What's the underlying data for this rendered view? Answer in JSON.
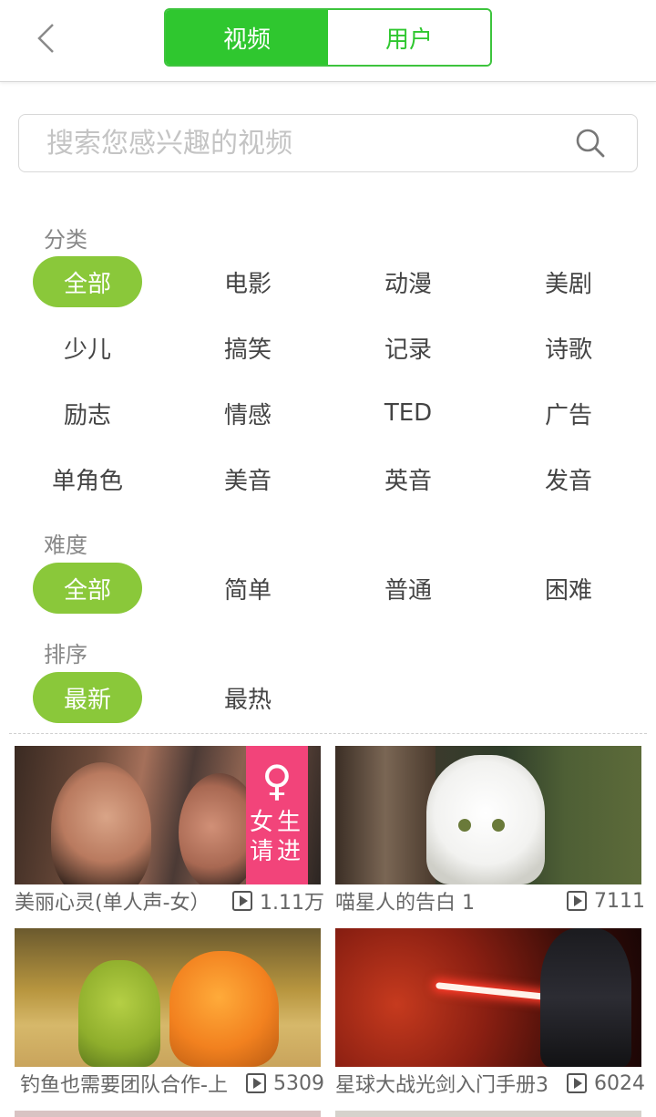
{
  "header": {
    "tabs": [
      {
        "label": "视频",
        "active": true
      },
      {
        "label": "用户",
        "active": false
      }
    ]
  },
  "search": {
    "placeholder": "搜索您感兴趣的视频"
  },
  "filters": {
    "category": {
      "label": "分类",
      "items": [
        "全部",
        "电影",
        "动漫",
        "美剧",
        "少儿",
        "搞笑",
        "记录",
        "诗歌",
        "励志",
        "情感",
        "TED",
        "广告",
        "单角色",
        "美音",
        "英音",
        "发音"
      ],
      "selected": "全部"
    },
    "difficulty": {
      "label": "难度",
      "items": [
        "全部",
        "简单",
        "普通",
        "困难"
      ],
      "selected": "全部"
    },
    "sort": {
      "label": "排序",
      "items": [
        "最新",
        "最热"
      ],
      "selected": "最新"
    }
  },
  "videos": [
    {
      "title": "美丽心灵(单人声-女）",
      "views": "1.11万",
      "badge": {
        "symbol": "♀",
        "line1": "女生",
        "line2": "请进"
      }
    },
    {
      "title": "喵星人的告白 1",
      "views": "7111"
    },
    {
      "title": "钓鱼也需要团队合作-上",
      "views": "5309"
    },
    {
      "title": "星球大战光剑入门手册3",
      "views": "6024"
    }
  ],
  "colors": {
    "tab_green": "#2fc72f",
    "chip_green": "#8ac83a",
    "badge_pink": "#f2447a"
  }
}
